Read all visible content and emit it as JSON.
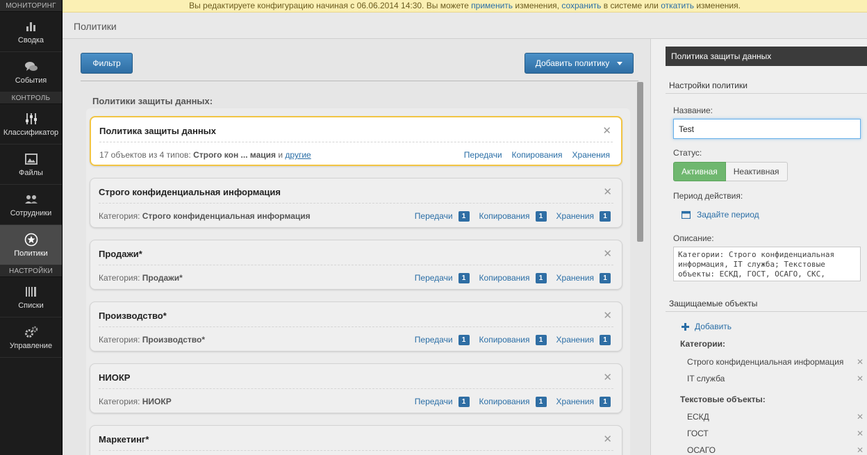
{
  "sidebar": {
    "sections": {
      "monitoring": "МОНИТОРИНГ",
      "control": "КОНТРОЛЬ",
      "settings": "НАСТРОЙКИ"
    },
    "items": [
      {
        "label": "Сводка",
        "icon": "bar-chart-icon"
      },
      {
        "label": "События",
        "icon": "chat-bubbles-icon"
      },
      {
        "label": "Классификатор",
        "icon": "sliders-icon"
      },
      {
        "label": "Файлы",
        "icon": "image-file-icon"
      },
      {
        "label": "Сотрудники",
        "icon": "users-icon"
      },
      {
        "label": "Политики",
        "icon": "star-shield-icon",
        "active": true
      },
      {
        "label": "Списки",
        "icon": "lists-icon"
      },
      {
        "label": "Управление",
        "icon": "gears-icon"
      }
    ]
  },
  "banner": {
    "text1": "Вы редактируете конфигурацию начиная с 06.06.2014 14:30. Вы можете ",
    "link_apply": "применить",
    "text2": " изменения, ",
    "link_save": "сохранить",
    "text3": " в системе или ",
    "link_rollback": "откатить",
    "text4": " изменения."
  },
  "page": {
    "title": "Политики"
  },
  "toolbar": {
    "filter_label": "Фильтр",
    "add_policy_label": "Добавить политику"
  },
  "policies": {
    "list_title": "Политики защиты данных:",
    "items": [
      {
        "title": "Политика защиты данных",
        "summary_prefix": "17 объектов из 4 типов: ",
        "summary_bold": "Строго кон ... мация",
        "summary_and": " и ",
        "summary_link": "другие",
        "links": [
          "Передачи",
          "Копирования",
          "Хранения"
        ]
      },
      {
        "title": "Строго конфиденциальная информация",
        "category_label": "Категория: ",
        "category": "Строго конфиденциальная информация",
        "links": [
          "Передачи",
          "Копирования",
          "Хранения"
        ],
        "counts": [
          "1",
          "1",
          "1"
        ]
      },
      {
        "title": "Продажи*",
        "category_label": "Категория: ",
        "category": "Продажи*",
        "links": [
          "Передачи",
          "Копирования",
          "Хранения"
        ],
        "counts": [
          "1",
          "1",
          "1"
        ]
      },
      {
        "title": "Производство*",
        "category_label": "Категория: ",
        "category": "Производство*",
        "links": [
          "Передачи",
          "Копирования",
          "Хранения"
        ],
        "counts": [
          "1",
          "1",
          "1"
        ]
      },
      {
        "title": "НИОКР",
        "category_label": "Категория: ",
        "category": "НИОКР",
        "links": [
          "Передачи",
          "Копирования",
          "Хранения"
        ],
        "counts": [
          "1",
          "1",
          "1"
        ]
      },
      {
        "title": "Маркетинг*"
      }
    ]
  },
  "panel": {
    "header": "Политика защиты данных",
    "settings_title": "Настройки политики",
    "name_label": "Название:",
    "name_value": "Test",
    "status_label": "Статус:",
    "status_active": "Активная",
    "status_inactive": "Неактивная",
    "period_label": "Период действия:",
    "period_link": "Задайте период",
    "description_label": "Описание:",
    "description_value": "Категории: Строго конфиденциальная информация, IT служба; Текстовые объекты: ЕСКД, ГОСТ, ОСАГО, СКС,",
    "protected_title": "Защищаемые объекты",
    "add_label": "Добавить",
    "categories_title": "Категории:",
    "categories": [
      "Строго конфиденциальная информация",
      "IT служба"
    ],
    "text_objects_title": "Текстовые объекты:",
    "text_objects": [
      "ЕСКД",
      "ГОСТ",
      "ОСАГО"
    ]
  },
  "colors": {
    "accent_blue": "#2f6ea4",
    "active_green": "#6fb76f",
    "selected_border": "#f2c543",
    "banner_bg": "#fbf0b4"
  }
}
